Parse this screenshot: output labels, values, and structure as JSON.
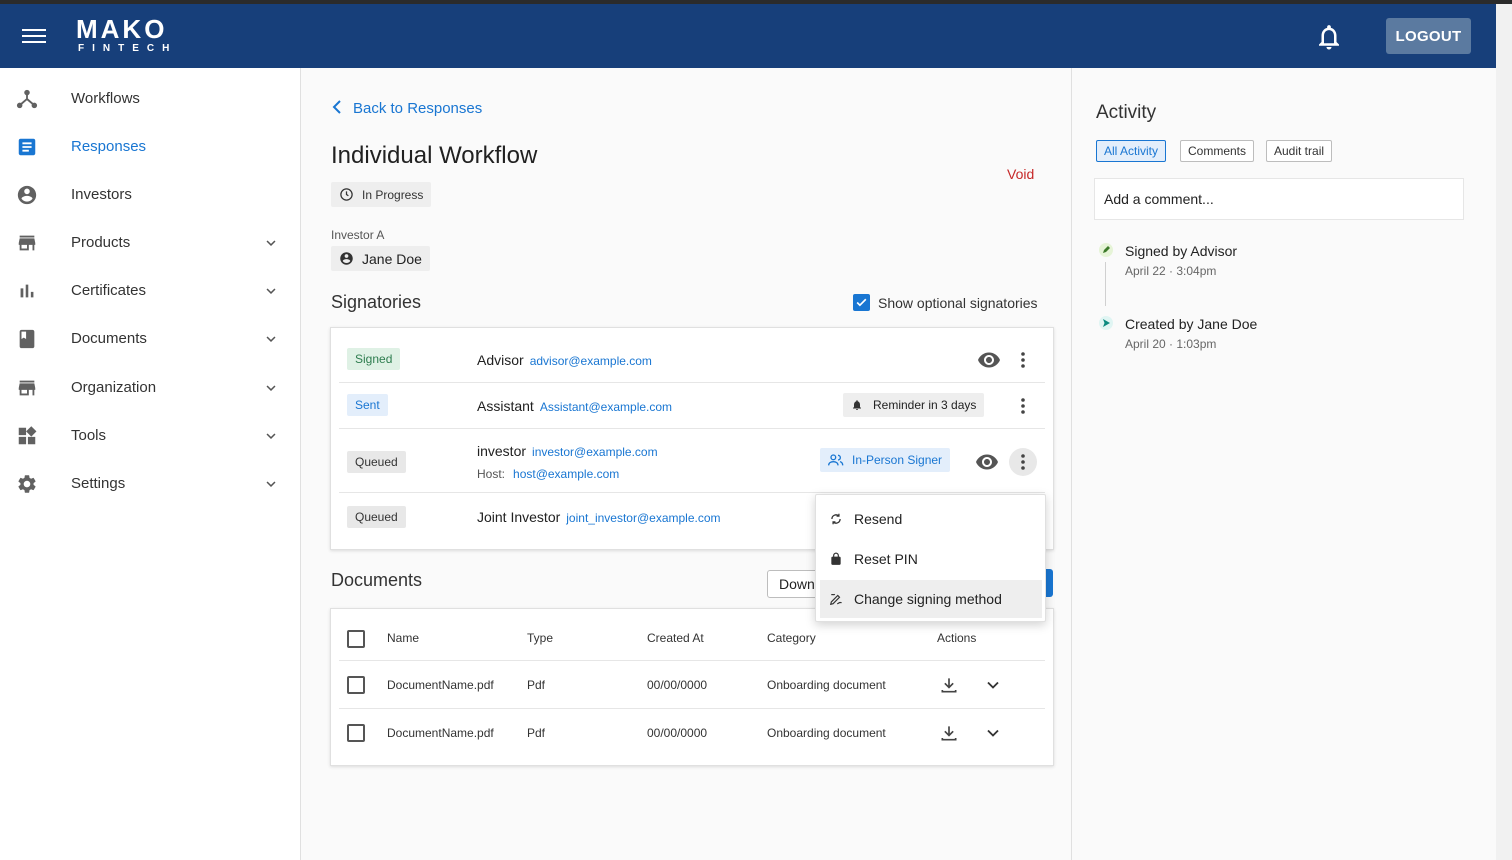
{
  "app": {
    "logo_top": "MAKO",
    "logo_bottom": "FINTECH",
    "logout_label": "LOGOUT",
    "icons": {
      "menu": "hamburger-icon",
      "notifications": "bell-icon"
    },
    "colors": {
      "appbar": "#173f7a",
      "accent": "#1976d2",
      "void": "#c62828"
    }
  },
  "sidebar": {
    "items": [
      {
        "label": "Workflows",
        "icon": "workflow-icon",
        "expandable": false,
        "active": false
      },
      {
        "label": "Responses",
        "icon": "document-text-icon",
        "expandable": false,
        "active": true
      },
      {
        "label": "Investors",
        "icon": "account-circle-icon",
        "expandable": false,
        "active": false
      },
      {
        "label": "Products",
        "icon": "storefront-icon",
        "expandable": true,
        "active": false
      },
      {
        "label": "Certificates",
        "icon": "bar-chart-icon",
        "expandable": true,
        "active": false
      },
      {
        "label": "Documents",
        "icon": "book-icon",
        "expandable": true,
        "active": false
      },
      {
        "label": "Organization",
        "icon": "store-icon",
        "expandable": true,
        "active": false
      },
      {
        "label": "Tools",
        "icon": "dashboard-icon",
        "expandable": true,
        "active": false
      },
      {
        "label": "Settings",
        "icon": "gear-icon",
        "expandable": true,
        "active": false
      }
    ]
  },
  "main": {
    "back_label": "Back to Responses",
    "title": "Individual Workflow",
    "void_label": "Void",
    "status": "In Progress",
    "investor_label": "Investor A",
    "investor_name": "Jane Doe",
    "signatories_title": "Signatories",
    "show_optional_label": "Show optional signatories",
    "show_optional_checked": true,
    "signatories": [
      {
        "status": "Signed",
        "role": "Advisor",
        "email": "advisor@example.com"
      },
      {
        "status": "Sent",
        "role": "Assistant",
        "email": "Assistant@example.com",
        "reminder": "Reminder in 3 days"
      },
      {
        "status": "Queued",
        "role": "investor",
        "email": "investor@example.com",
        "host_label": "Host:",
        "host_email": "host@example.com",
        "signer_type": "In-Person Signer"
      },
      {
        "status": "Queued",
        "role": "Joint Investor",
        "email": "joint_investor@example.com"
      }
    ],
    "documents_title": "Documents",
    "download_label": "Down",
    "documents_table": {
      "headers": [
        "Name",
        "Type",
        "Created At",
        "Category",
        "Actions"
      ],
      "rows": [
        {
          "name": "DocumentName.pdf",
          "type": "Pdf",
          "created": "00/00/0000",
          "category": "Onboarding document"
        },
        {
          "name": "DocumentName.pdf",
          "type": "Pdf",
          "created": "00/00/0000",
          "category": "Onboarding document"
        }
      ]
    },
    "context_menu": {
      "items": [
        {
          "label": "Resend",
          "icon": "refresh-icon"
        },
        {
          "label": "Reset PIN",
          "icon": "lock-icon"
        },
        {
          "label": "Change signing method",
          "icon": "signature-edit-icon",
          "highlighted": true
        }
      ]
    }
  },
  "activity": {
    "title": "Activity",
    "tabs": [
      "All Activity",
      "Comments",
      "Audit trail"
    ],
    "active_tab": "All Activity",
    "comment_placeholder": "Add a comment...",
    "events": [
      {
        "title": "Signed by Advisor",
        "date": "April 22 · 3:04pm",
        "icon": "pen-icon"
      },
      {
        "title": "Created by Jane Doe",
        "date": "April 20 · 1:03pm",
        "icon": "send-icon"
      }
    ]
  }
}
